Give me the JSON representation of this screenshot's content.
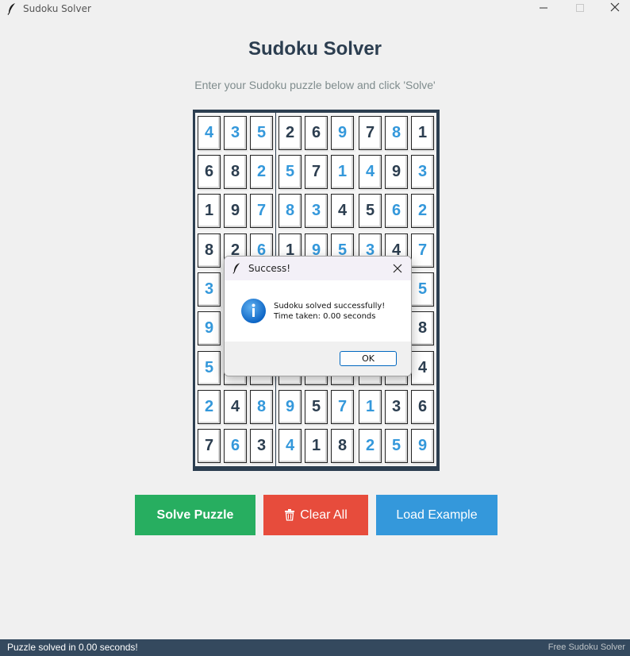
{
  "window": {
    "title": "Sudoku Solver"
  },
  "header": {
    "title": "Sudoku Solver",
    "subtitle": "Enter your Sudoku puzzle below and click 'Solve'"
  },
  "board": {
    "values": [
      [
        4,
        3,
        5,
        2,
        6,
        9,
        7,
        8,
        1
      ],
      [
        6,
        8,
        2,
        5,
        7,
        1,
        4,
        9,
        3
      ],
      [
        1,
        9,
        7,
        8,
        3,
        4,
        5,
        6,
        2
      ],
      [
        8,
        2,
        6,
        1,
        9,
        5,
        3,
        4,
        7
      ],
      [
        3,
        "",
        "",
        "",
        "",
        "",
        "",
        "",
        5
      ],
      [
        9,
        "",
        "",
        "",
        "",
        "",
        "",
        "",
        8
      ],
      [
        5,
        "",
        "",
        "",
        "",
        "",
        "",
        "",
        4
      ],
      [
        2,
        4,
        8,
        9,
        5,
        7,
        1,
        3,
        6
      ],
      [
        7,
        6,
        3,
        4,
        1,
        8,
        2,
        5,
        9
      ]
    ],
    "solved": [
      [
        1,
        1,
        1,
        0,
        0,
        1,
        0,
        1,
        0
      ],
      [
        0,
        0,
        1,
        1,
        0,
        1,
        1,
        0,
        1
      ],
      [
        0,
        0,
        1,
        1,
        1,
        0,
        0,
        1,
        1
      ],
      [
        0,
        0,
        1,
        0,
        1,
        1,
        1,
        0,
        1
      ],
      [
        1,
        0,
        0,
        0,
        0,
        0,
        0,
        0,
        1
      ],
      [
        1,
        0,
        0,
        0,
        0,
        0,
        0,
        0,
        0
      ],
      [
        1,
        0,
        0,
        0,
        0,
        0,
        0,
        0,
        0
      ],
      [
        1,
        0,
        1,
        1,
        0,
        1,
        1,
        0,
        0
      ],
      [
        0,
        1,
        0,
        1,
        0,
        0,
        1,
        1,
        1
      ]
    ],
    "colors": {
      "given": "#2c3e50",
      "solved": "#3498db",
      "frame": "#2c3e50"
    }
  },
  "buttons": {
    "solve": "Solve Puzzle",
    "clear": "Clear All",
    "load": "Load Example",
    "colors": {
      "solve": "#27ae60",
      "clear": "#e74c3c",
      "load": "#3498db"
    }
  },
  "dialog": {
    "title": "Success!",
    "message_line1": "Sudoku solved successfully!",
    "message_line2": "Time taken: 0.00 seconds",
    "ok": "OK",
    "icon": "info-icon"
  },
  "status": {
    "left": "Puzzle solved in 0.00 seconds!",
    "right": "Free Sudoku Solver"
  }
}
